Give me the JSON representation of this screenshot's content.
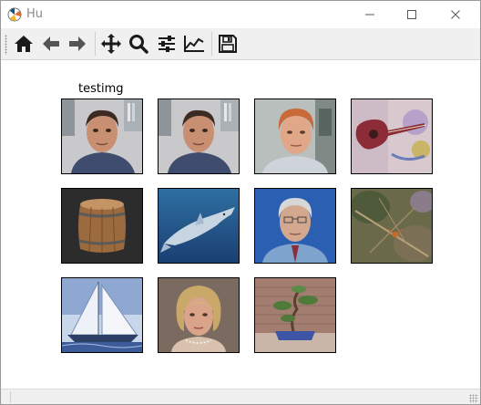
{
  "window": {
    "title": "Hu"
  },
  "toolbar": {
    "items": [
      {
        "name": "home-icon"
      },
      {
        "name": "back-arrow-icon"
      },
      {
        "name": "forward-arrow-icon"
      },
      {
        "name": "pan-move-icon"
      },
      {
        "name": "zoom-magnifier-icon"
      },
      {
        "name": "configure-subplots-icon"
      },
      {
        "name": "edit-axis-icon"
      },
      {
        "name": "save-figure-icon"
      }
    ]
  },
  "figure": {
    "title": "testimg",
    "images": [
      {
        "subject": "man-face-1"
      },
      {
        "subject": "man-face-1-copy"
      },
      {
        "subject": "red-haired-man"
      },
      {
        "subject": "guitar-painting"
      },
      {
        "subject": "wooden-barrel"
      },
      {
        "subject": "dolphin"
      },
      {
        "subject": "grey-haired-man"
      },
      {
        "subject": "insect-on-branch"
      },
      {
        "subject": "sailboat"
      },
      {
        "subject": "blonde-woman"
      },
      {
        "subject": "bonsai-tree"
      }
    ]
  },
  "colors": {
    "toolbar_bg": "#f0f0f0",
    "canvas_bg": "#ffffff",
    "icon": "#1a1a1a"
  }
}
